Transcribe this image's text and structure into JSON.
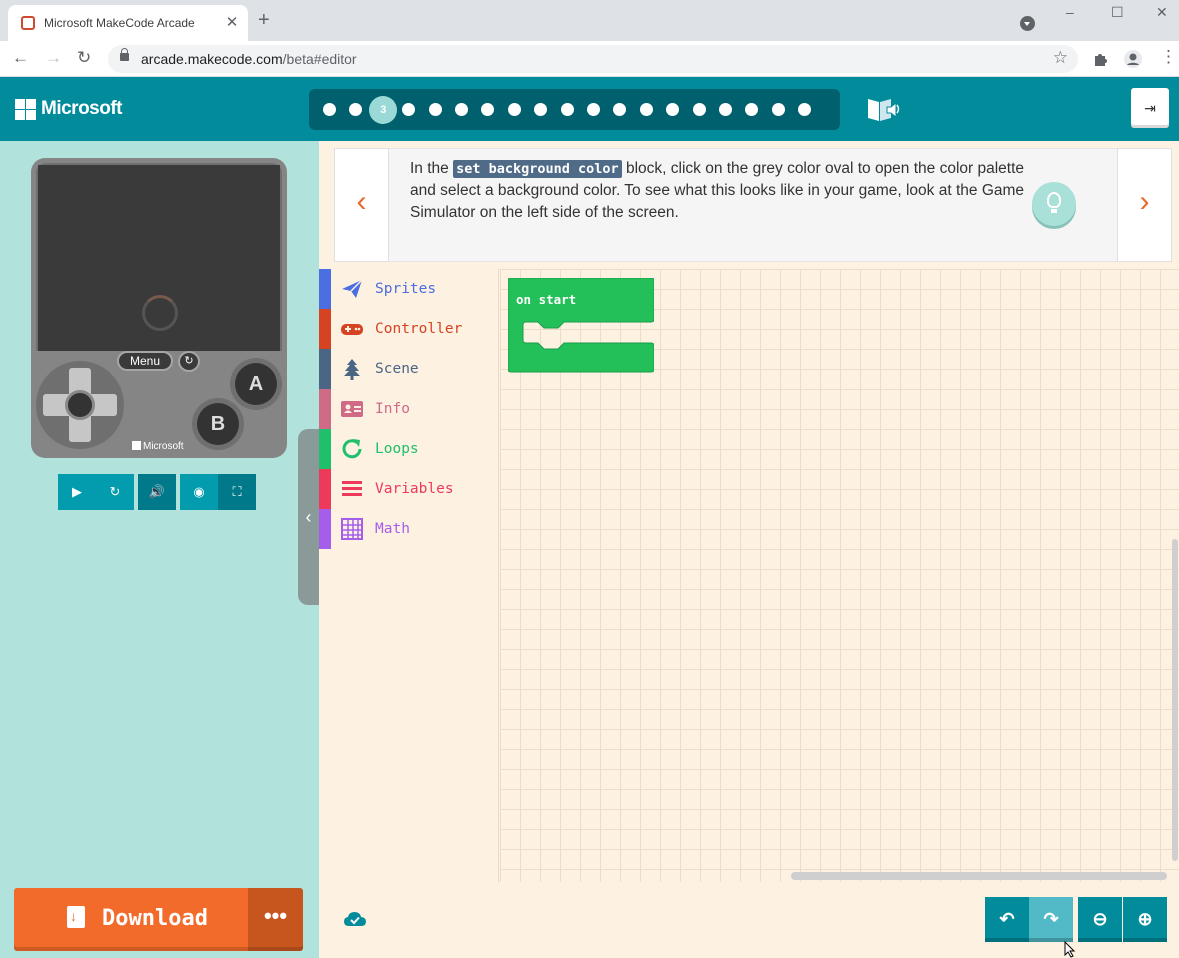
{
  "browser": {
    "tab_title": "Microsoft MakeCode Arcade",
    "tab_close": "✕",
    "new_tab": "+",
    "url_host": "arcade.makecode.com",
    "url_path": "/beta#editor",
    "window_controls": [
      "–",
      "☐",
      "✕"
    ]
  },
  "header": {
    "brand": "Microsoft",
    "current_step_label": "3",
    "total_steps": 19,
    "current_step": 3
  },
  "simulator": {
    "menu_label": "Menu",
    "button_a": "A",
    "button_b": "B",
    "console_brand": "Microsoft",
    "controls": [
      "play",
      "restart",
      "mute",
      "screenshot",
      "fullscreen"
    ]
  },
  "download": {
    "label": "Download",
    "more": "•••"
  },
  "tutorial": {
    "text_before": "In the ",
    "code": "set background color",
    "text_after": " block, click on the grey color oval to open the color palette and select a background color. To see what this looks like in your game, look at the Game Simulator on the left side of the screen.",
    "prev_glyph": "‹",
    "next_glyph": "›"
  },
  "toolbox": [
    {
      "label": "Sprites",
      "color": "#4b6ee0",
      "icon": "paper-plane-icon"
    },
    {
      "label": "Controller",
      "color": "#d54322",
      "icon": "gamepad-icon"
    },
    {
      "label": "Scene",
      "color": "#4b6584",
      "icon": "tree-icon"
    },
    {
      "label": "Info",
      "color": "#cf6a87",
      "icon": "id-card-icon"
    },
    {
      "label": "Loops",
      "color": "#20bf6b",
      "icon": "refresh-icon"
    },
    {
      "label": "Variables",
      "color": "#ee3a5a",
      "icon": "list-icon"
    },
    {
      "label": "Math",
      "color": "#a55eea",
      "icon": "calculator-icon"
    }
  ],
  "workspace": {
    "block_label": "on start",
    "block_color": "#23c05a"
  },
  "colors": {
    "header": "#028b9b",
    "simulator_bg": "#b1e3dc",
    "workspace_bg": "#fdf1e2",
    "download": "#f26b2a",
    "sim_button": "#028b9b"
  }
}
